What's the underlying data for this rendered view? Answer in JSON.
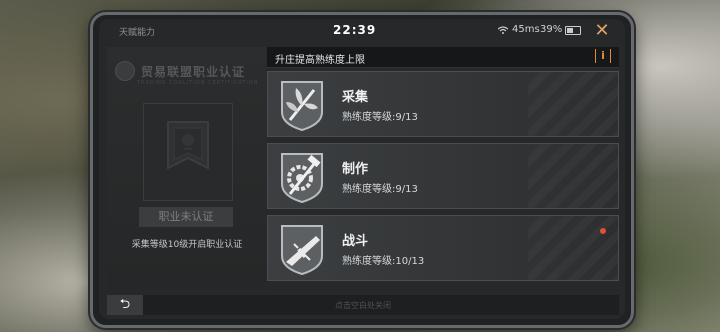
{
  "status": {
    "title": "天赋能力",
    "time": "22:39",
    "ping": "45ms",
    "battery": "39%"
  },
  "left_panel": {
    "org_name": "贸易联盟职业认证",
    "org_sub": "TRADING COALITION CERTIFICATION",
    "cert_status": "职业未认证",
    "cert_hint": "采集等级10级开启职业认证"
  },
  "header": {
    "title": "升庄提高熟练度上限",
    "info_label": "i"
  },
  "skills": [
    {
      "name": "采集",
      "level": "熟练度等级:9/13",
      "icon": "plant-gathering-icon",
      "notify": false
    },
    {
      "name": "制作",
      "level": "熟练度等级:9/13",
      "icon": "crafting-gear-hammer-icon",
      "notify": false
    },
    {
      "name": "战斗",
      "level": "熟练度等级:10/13",
      "icon": "combat-rifle-icon",
      "notify": true
    }
  ],
  "bottom": {
    "back_label": "⮌",
    "close_hint": "点击空白处关闭"
  },
  "colors": {
    "accent": "#e58a3a",
    "notify": "#e24b2d"
  }
}
